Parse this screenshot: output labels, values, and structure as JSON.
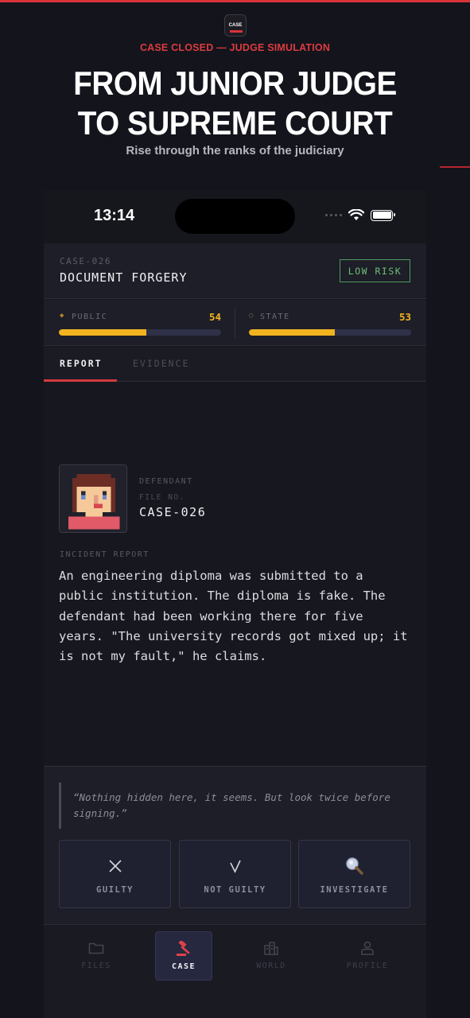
{
  "promo": {
    "kicker": "CASE CLOSED — JUDGE SIMULATION",
    "title_line1": "FROM JUNIOR JUDGE",
    "title_line2": "TO SUPREME COURT",
    "subtitle": "Rise through the ranks of the judiciary",
    "logo_text": "CASE"
  },
  "status_bar": {
    "time": "13:14",
    "icons": [
      "signal-icon",
      "wifi-icon",
      "battery-icon"
    ]
  },
  "case": {
    "id_label": "CASE-026",
    "title": "DOCUMENT FORGERY",
    "risk_badge": "LOW RISK",
    "risk_color": "#4e9a5c"
  },
  "meters": {
    "public": {
      "label": "PUBLIC",
      "value": "54",
      "fraction": 0.54,
      "icon": "diamond-icon"
    },
    "state": {
      "label": "STATE",
      "value": "53",
      "fraction": 0.53,
      "icon": "circle-icon"
    },
    "fill_color": "#f2b320"
  },
  "tabs": [
    {
      "label": "REPORT",
      "active": true
    },
    {
      "label": "EVIDENCE",
      "active": false
    }
  ],
  "defendant": {
    "label": "DEFENDANT",
    "file_label": "FILE NO.",
    "file_no": "CASE-026"
  },
  "incident": {
    "label": "INCIDENT REPORT",
    "text": "An engineering diploma was submitted to a public institution. The diploma is fake. The defendant had been working there for five years. \"The university records got mixed up; it is not my fault,\" he claims."
  },
  "quote": "“Nothing hidden here, it seems. But look twice before signing.”",
  "actions": [
    {
      "label": "GUILTY",
      "icon": "×"
    },
    {
      "label": "NOT GUILTY",
      "icon": "√"
    },
    {
      "label": "INVESTIGATE",
      "icon": "magnifier-icon"
    }
  ],
  "nav": [
    {
      "label": "FILES",
      "icon": "folder-icon",
      "active": false
    },
    {
      "label": "CASE",
      "icon": "gavel-icon",
      "active": true
    },
    {
      "label": "WORLD",
      "icon": "buildings-icon",
      "active": false
    },
    {
      "label": "PROFILE",
      "icon": "person-icon",
      "active": false
    }
  ],
  "colors": {
    "accent": "#d9333a",
    "background": "#13141c",
    "gold": "#f2b320"
  }
}
